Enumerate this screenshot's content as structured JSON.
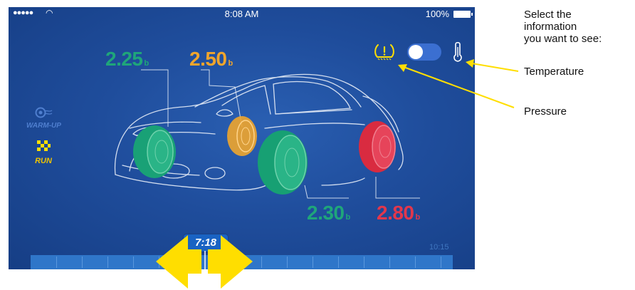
{
  "status_bar": {
    "time": "8:08 AM",
    "battery": "100%"
  },
  "modes": {
    "warmup": "WARM-UP",
    "run": "RUN"
  },
  "readings": {
    "front_left": {
      "value": "2.25",
      "unit": "b"
    },
    "rear_left": {
      "value": "2.50",
      "unit": "b"
    },
    "front_right": {
      "value": "2.30",
      "unit": "b"
    },
    "rear_right": {
      "value": "2.80",
      "unit": "b"
    }
  },
  "timeline": {
    "current": "7:18",
    "end": "10:15"
  },
  "annotations": {
    "line1": "Select the",
    "line2": "information",
    "line3": "you want to see:",
    "temperature": "Temperature",
    "pressure": "Pressure"
  },
  "colors": {
    "green": "#1fa67a",
    "orange": "#f0a52c",
    "red": "#e2374c",
    "yellow": "#ffde00"
  },
  "icons": [
    "tpms-warning-icon",
    "toggle-switch",
    "thermometer-icon",
    "tire-warmup-icon",
    "checkered-flag-icon"
  ]
}
